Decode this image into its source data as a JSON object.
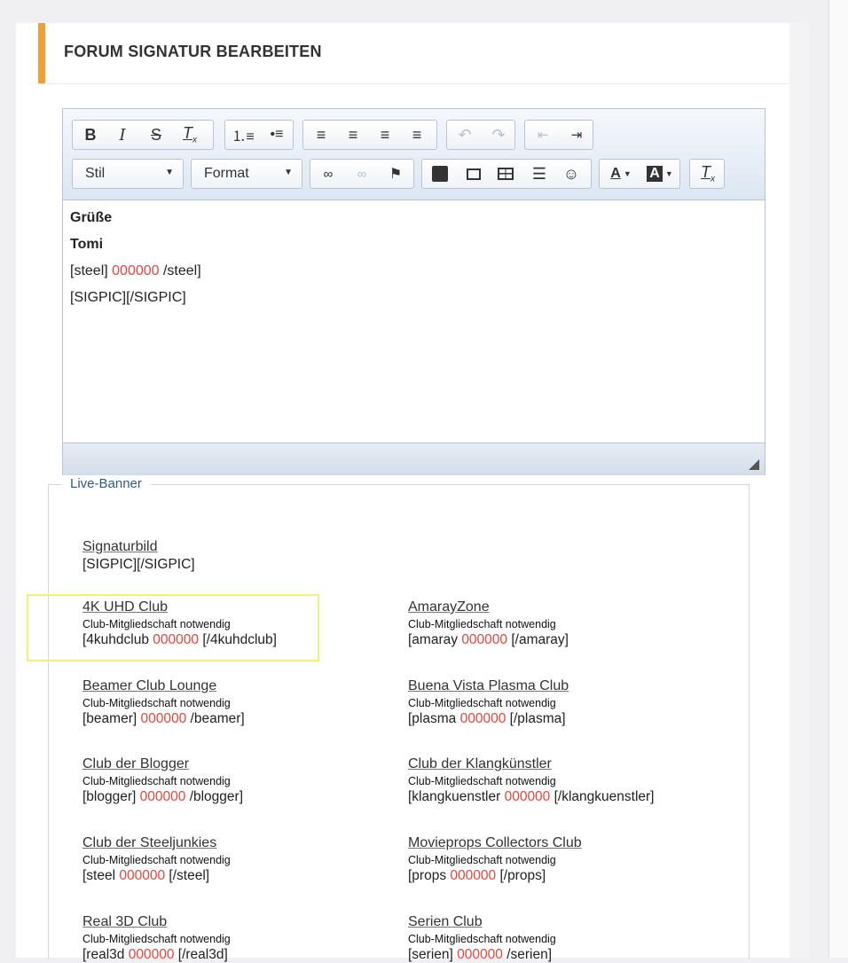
{
  "page": {
    "title": "FORUM SIGNATUR BEARBEITEN"
  },
  "toolbar": {
    "row1": [
      {
        "name": "bold-button",
        "label": "B"
      },
      {
        "name": "italic-button",
        "label": "I"
      },
      {
        "name": "strikethrough-button",
        "label": "S"
      },
      {
        "name": "remove-format-button",
        "label": "Tx"
      },
      {
        "name": "numbered-list-button",
        "label": "≡"
      },
      {
        "name": "bullet-list-button",
        "label": "≡"
      },
      {
        "name": "align-left-button",
        "label": "≡"
      },
      {
        "name": "align-center-button",
        "label": "≡"
      },
      {
        "name": "align-right-button",
        "label": "≡"
      },
      {
        "name": "justify-button",
        "label": "≡"
      },
      {
        "name": "undo-button",
        "label": "↶"
      },
      {
        "name": "redo-button",
        "label": "↷"
      },
      {
        "name": "outdent-button",
        "label": "⇤"
      },
      {
        "name": "indent-button",
        "label": "⇥"
      }
    ],
    "style_combo": "Stil",
    "format_combo": "Format",
    "icons": {
      "bold": "bold-icon",
      "italic": "italic-icon",
      "strike": "strikethrough-icon",
      "clear": "clear-format-icon",
      "ol": "numbered-list-icon",
      "ul": "bullet-list-icon",
      "al": "align-left-icon",
      "ac": "align-center-icon",
      "ar": "align-right-icon",
      "aj": "justify-icon",
      "undo": "undo-icon",
      "redo": "redo-icon",
      "outdent": "outdent-icon",
      "indent": "indent-icon",
      "link": "link-icon",
      "unlink": "unlink-icon",
      "anchor": "flag-icon",
      "youtube": "youtube-icon",
      "image": "image-icon",
      "table": "table-icon",
      "hr": "horizontal-rule-icon",
      "smiley": "smiley-icon",
      "textcolor": "text-color-icon",
      "bgcolor": "background-color-icon",
      "clear2": "clear-format-icon"
    }
  },
  "editor": {
    "line1": "Grüße",
    "line2": "Tomi",
    "line3_pre": "[steel]",
    "line3_red": "000000",
    "line3_post": "/steel]",
    "line4": "[SIGPIC][/SIGPIC]"
  },
  "live_banner": {
    "legend": "Live-Banner",
    "signature": {
      "name": "Signaturbild",
      "code": "[SIGPIC][/SIGPIC]"
    },
    "note": "Club-Mitgliedschaft notwendig",
    "clubs": [
      {
        "name": "4K UHD Club",
        "pre": "[4kuhdclub",
        "red": "000000",
        "post": "[/4kuhdclub]"
      },
      {
        "name": "AmarayZone",
        "pre": "[amaray",
        "red": "000000",
        "post": "[/amaray]"
      },
      {
        "name": "Beamer Club Lounge",
        "pre": "[beamer]",
        "red": "000000",
        "post": "/beamer]"
      },
      {
        "name": "Buena Vista Plasma Club",
        "pre": "[plasma",
        "red": "000000",
        "post": "[/plasma]"
      },
      {
        "name": "Club der Blogger",
        "pre": "[blogger]",
        "red": "000000",
        "post": "/blogger]"
      },
      {
        "name": "Club der Klangkünstler",
        "pre": "[klangkuenstler",
        "red": "000000",
        "post": "[/klangkuenstler]"
      },
      {
        "name": "Club der Steeljunkies",
        "pre": "[steel",
        "red": "000000",
        "post": "[/steel]"
      },
      {
        "name": "Movieprops Collectors Club",
        "pre": "[props",
        "red": "000000",
        "post": "[/props]"
      },
      {
        "name": "Real 3D Club",
        "pre": "[real3d",
        "red": "000000",
        "post": "[/real3d]"
      },
      {
        "name": "Serien Club",
        "pre": "[serien]",
        "red": "000000",
        "post": "/serien]"
      }
    ]
  },
  "colors": {
    "accent": "#f0a030",
    "highlight": "#f5f070",
    "code_red": "#e8453c",
    "legend": "#2e5a88"
  }
}
